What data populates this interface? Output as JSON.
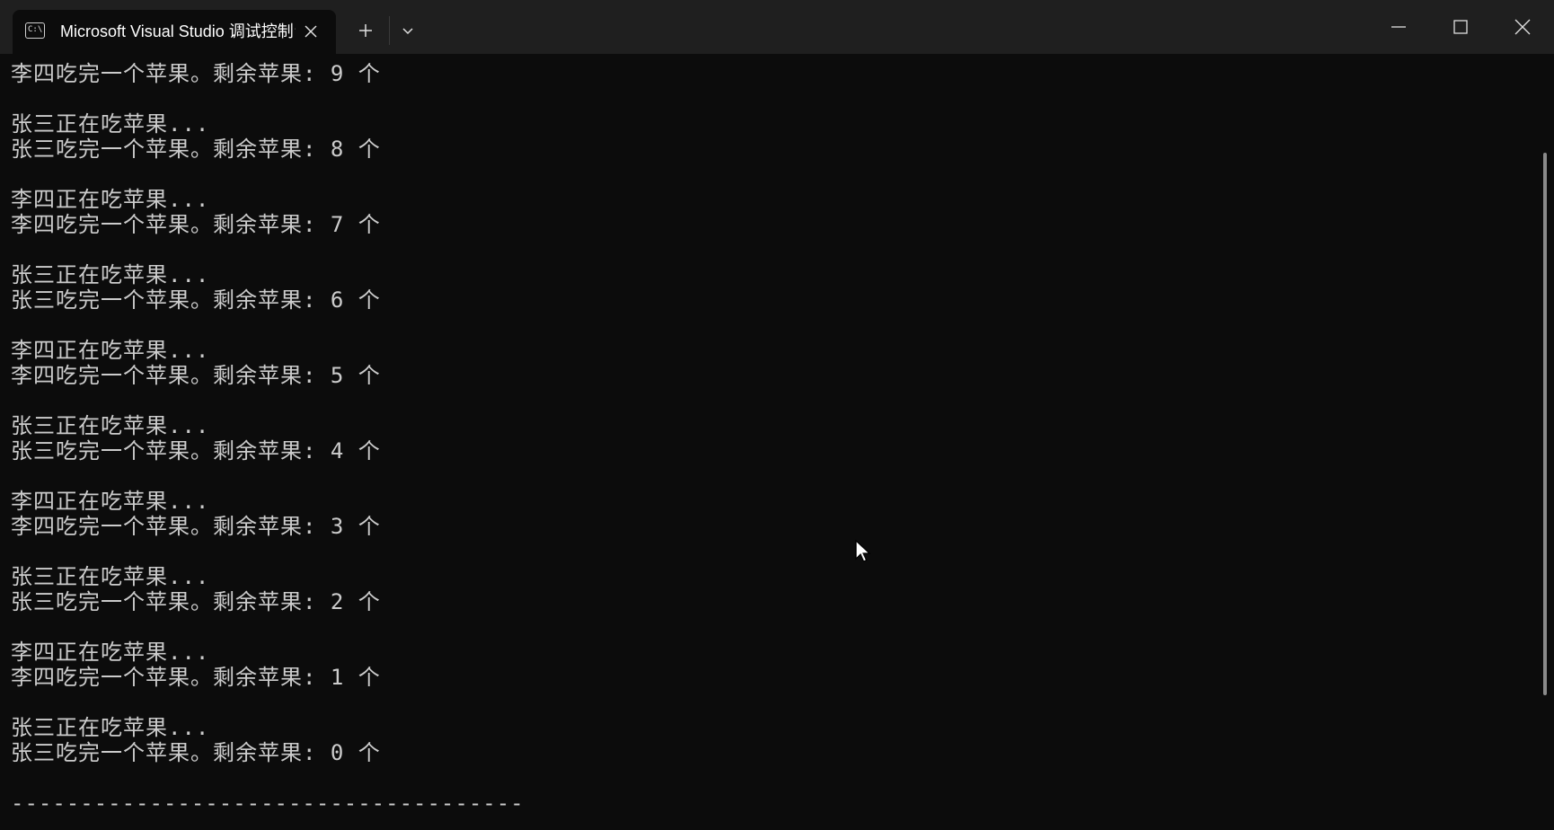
{
  "window": {
    "tab_title": "Microsoft Visual Studio 调试控制台",
    "tab_icon_text": "C:\\",
    "icons": {
      "tab_icon": "console-icon",
      "tab_close": "close-icon",
      "new_tab": "plus-icon",
      "dropdown": "chevron-down-icon",
      "minimize": "minimize-icon",
      "maximize": "maximize-icon",
      "close": "close-icon"
    }
  },
  "console": {
    "lines": [
      "李四吃完一个苹果。剩余苹果: 9 个",
      "",
      "张三正在吃苹果...",
      "张三吃完一个苹果。剩余苹果: 8 个",
      "",
      "李四正在吃苹果...",
      "李四吃完一个苹果。剩余苹果: 7 个",
      "",
      "张三正在吃苹果...",
      "张三吃完一个苹果。剩余苹果: 6 个",
      "",
      "李四正在吃苹果...",
      "李四吃完一个苹果。剩余苹果: 5 个",
      "",
      "张三正在吃苹果...",
      "张三吃完一个苹果。剩余苹果: 4 个",
      "",
      "李四正在吃苹果...",
      "李四吃完一个苹果。剩余苹果: 3 个",
      "",
      "张三正在吃苹果...",
      "张三吃完一个苹果。剩余苹果: 2 个",
      "",
      "李四正在吃苹果...",
      "李四吃完一个苹果。剩余苹果: 1 个",
      "",
      "张三正在吃苹果...",
      "张三吃完一个苹果。剩余苹果: 0 个",
      "",
      "-------------------------------------"
    ]
  },
  "colors": {
    "background": "#0c0c0c",
    "titlebar": "#1f1f1f",
    "text": "#cccccc"
  }
}
